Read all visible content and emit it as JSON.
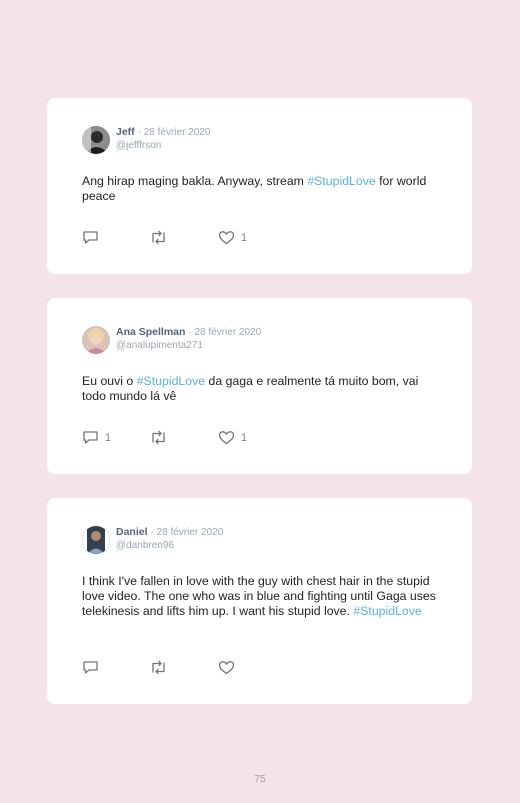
{
  "tweets": [
    {
      "name": "Jeff",
      "date": "· 28 février 2020",
      "handle": "@jefffrson",
      "text_before": "Ang hirap maging bakla. Anyway, stream ",
      "hashtag": "#StupidLove",
      "text_after": " for world peace",
      "reply_count": "",
      "retweet_count": "",
      "like_count": "1"
    },
    {
      "name": "Ana Spellman",
      "date": "· 28 février 2020",
      "handle": "@analupimenta271",
      "text_before": "Eu ouvi o ",
      "hashtag": "#StupidLove",
      "text_after": " da gaga e realmente tá muito bom, vai todo mundo lá vê",
      "reply_count": "1",
      "retweet_count": "",
      "like_count": "1"
    },
    {
      "name": "Daniel",
      "date": "· 28 février 2020",
      "handle": "@danbren96",
      "text_before": "I think I've fallen in love with the guy with chest hair in the stupid love video. The one who was in blue and fighting until Gaga uses telekinesis and lifts him up. I want his stupid love. ",
      "hashtag": "#StupidLove",
      "text_after": "",
      "reply_count": "",
      "retweet_count": "",
      "like_count": ""
    }
  ],
  "page_number": "75",
  "colors": {
    "background": "#f4e4e8",
    "card": "#ffffff",
    "hashtag": "#5bb2de",
    "name": "#53647a",
    "muted": "#9aa6b2"
  },
  "icons": [
    "reply-icon",
    "retweet-icon",
    "like-icon"
  ]
}
